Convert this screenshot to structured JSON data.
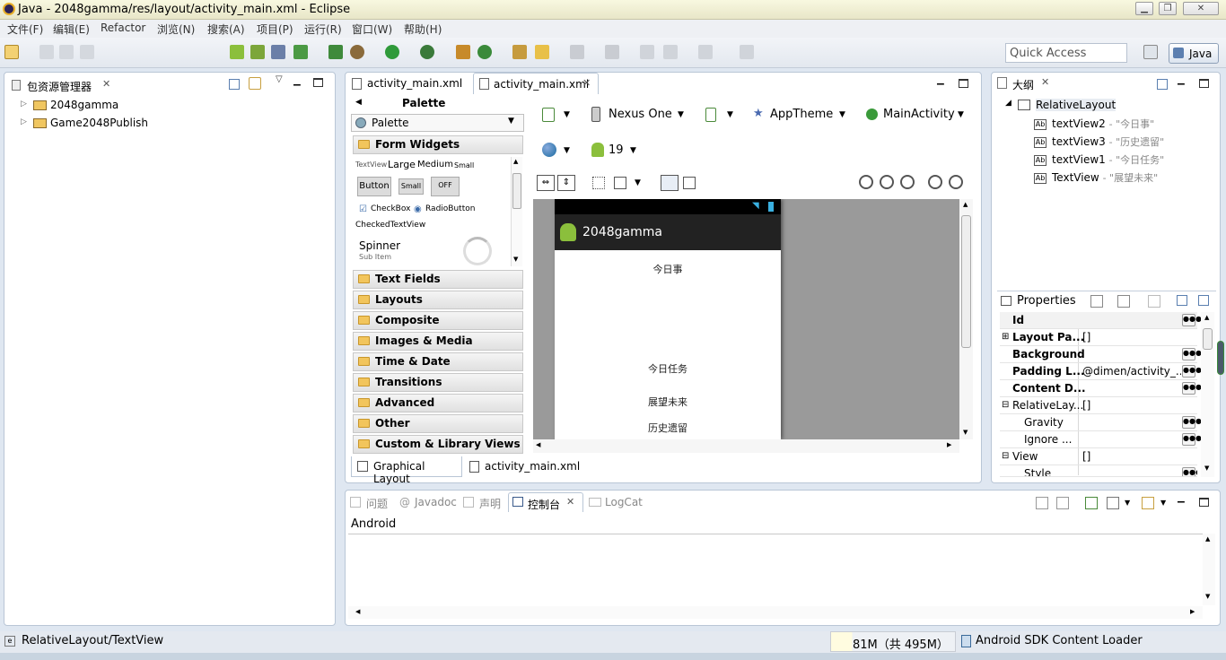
{
  "window": {
    "title": "Java - 2048gamma/res/layout/activity_main.xml - Eclipse",
    "min": "▁",
    "max": "❐",
    "close": "✕"
  },
  "menu": [
    "文件(F)",
    "编辑(E)",
    "Refactor",
    "浏览(N)",
    "搜索(A)",
    "项目(P)",
    "运行(R)",
    "窗口(W)",
    "帮助(H)"
  ],
  "toolbar": {
    "quick_access_placeholder": "Quick Access",
    "perspective": "Java"
  },
  "package_explorer": {
    "title": "包资源管理器",
    "items": [
      "2048gamma",
      "Game2048Publish"
    ]
  },
  "editor": {
    "tabs": [
      "activity_main.xml",
      "activity_main.xml"
    ],
    "palette_title": "Palette",
    "palette_dropdown": "Palette",
    "form_widgets": "Form Widgets",
    "widgets": {
      "textview": "TextView",
      "large": "Large",
      "medium": "Medium",
      "small": "Small",
      "button": "Button",
      "small_button": "Small",
      "toggle": "OFF",
      "checkbox": "CheckBox",
      "radio": "RadioButton",
      "checkedtextview": "CheckedTextView",
      "spinner": "Spinner",
      "sub_item": "Sub Item"
    },
    "categories": [
      "Text Fields",
      "Layouts",
      "Composite",
      "Images & Media",
      "Time & Date",
      "Transitions",
      "Advanced",
      "Other",
      "Custom & Library Views"
    ],
    "config": {
      "device": "Nexus One",
      "theme": "AppTheme",
      "activity": "MainActivity",
      "api": "19"
    },
    "device_preview": {
      "app_title": "2048gamma",
      "texts": [
        "今日事",
        "今日任务",
        "展望未来",
        "历史遗留"
      ]
    },
    "bottom_tabs": [
      "Graphical Layout",
      "activity_main.xml"
    ]
  },
  "outline": {
    "title": "大纲",
    "root": "RelativeLayout",
    "items": [
      {
        "id": "textView2",
        "value": "- \"今日事\""
      },
      {
        "id": "textView3",
        "value": "- \"历史遗留\""
      },
      {
        "id": "textView1",
        "value": "- \"今日任务\""
      },
      {
        "id": "TextView",
        "value": "- \"展望未来\""
      }
    ]
  },
  "properties": {
    "title": "Properties",
    "rows": [
      {
        "name": "Id",
        "value": ""
      },
      {
        "name": "Layout Pa...",
        "value": "[]"
      },
      {
        "name": "Background",
        "value": ""
      },
      {
        "name": "Padding L...",
        "value": "@dimen/activity_..."
      },
      {
        "name": "Content D...",
        "value": ""
      },
      {
        "name": "RelativeLay...",
        "value": "[]"
      },
      {
        "name": "Gravity",
        "value": ""
      },
      {
        "name": "Ignore ...",
        "value": ""
      },
      {
        "name": "View",
        "value": "[]"
      },
      {
        "name": "Style",
        "value": ""
      }
    ]
  },
  "console": {
    "tabs": [
      "问题",
      "Javadoc",
      "声明",
      "控制台",
      "LogCat"
    ],
    "label": "Android"
  },
  "status": {
    "path": "RelativeLayout/TextView",
    "heap": "81M（共 495M）",
    "loader": "Android SDK Content Loader"
  }
}
